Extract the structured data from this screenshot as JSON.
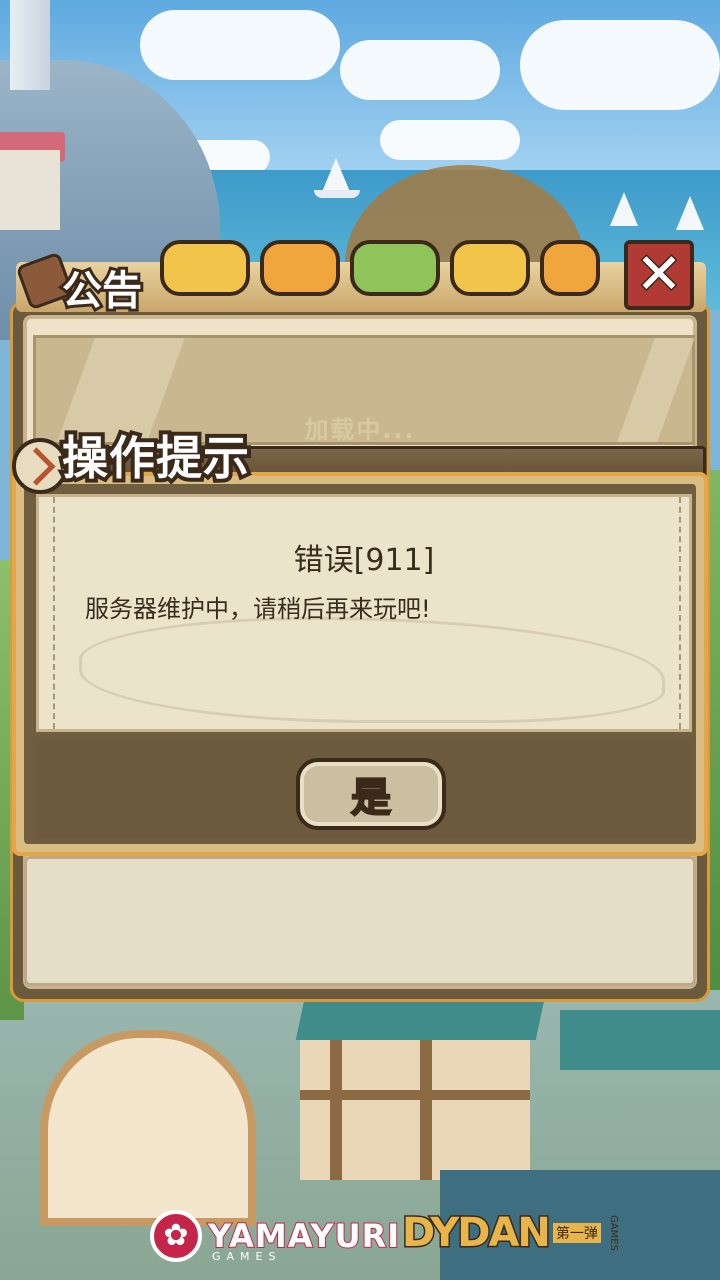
{
  "notice": {
    "title": "公告",
    "loading": "加载中...",
    "close_label": "✕"
  },
  "dialog": {
    "title": "操作提示",
    "error_title": "错误[911]",
    "message": "服务器维护中，请稍后再来玩吧!",
    "confirm_label": "是"
  },
  "footer": {
    "logo_left": "YAMAYURI",
    "logo_left_sub": "GAMES",
    "logo_right": "DYDAN",
    "logo_right_sub": "第一弹",
    "logo_right_side": "GAMES"
  },
  "colors": {
    "accent_orange": "#e3a64a",
    "close_red": "#b23a34",
    "panel_brown": "#6b5a3e",
    "paper": "#ece3cb"
  }
}
